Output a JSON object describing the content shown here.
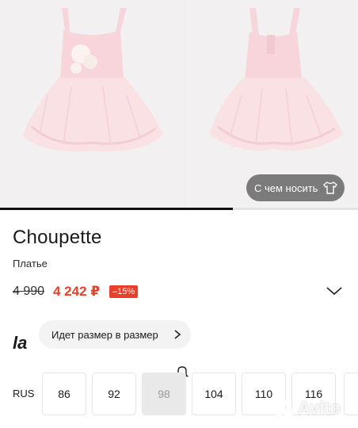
{
  "product": {
    "brand": "Choupette",
    "type": "Платье",
    "old_price": "4 990",
    "new_price": "4 242 ₽",
    "discount": "–15%"
  },
  "gallery": {
    "outfit_button": "С чем носить",
    "progress": 0.65
  },
  "fit": {
    "logo": "la",
    "label": "Идет размер в размер"
  },
  "sizes": {
    "label": "RUS",
    "items": [
      {
        "value": "86",
        "available": true
      },
      {
        "value": "92",
        "available": true
      },
      {
        "value": "98",
        "available": false
      },
      {
        "value": "104",
        "available": true
      },
      {
        "value": "110",
        "available": true
      },
      {
        "value": "116",
        "available": true
      }
    ]
  },
  "watermark": "Avito",
  "colors": {
    "accent_price": "#e8402a",
    "dress_pink": "#f7d9de"
  }
}
